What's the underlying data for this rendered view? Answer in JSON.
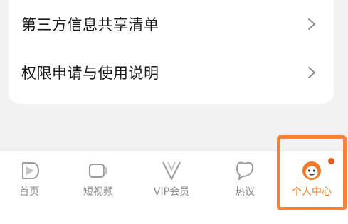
{
  "settings_list": {
    "items": [
      {
        "label": "第三方信息共享清单",
        "icon": "chevron-right-icon"
      },
      {
        "label": "权限申请与使用说明",
        "icon": "chevron-right-icon"
      }
    ]
  },
  "tab_bar": {
    "tabs": [
      {
        "label": "首页",
        "icon": "home-play-icon",
        "active": false
      },
      {
        "label": "短视频",
        "icon": "video-camera-icon",
        "active": false
      },
      {
        "label": "VIP会员",
        "icon": "vip-v-icon",
        "active": false
      },
      {
        "label": "热议",
        "icon": "comment-bubble-icon",
        "active": false
      },
      {
        "label": "个人中心",
        "icon": "profile-face-icon",
        "active": true,
        "badge": "red-dot"
      }
    ]
  },
  "colors": {
    "accent": "#f07a25",
    "highlight_frame": "#f0843c",
    "badge_dot": "#f2541e",
    "inactive_text": "#8a8a8a",
    "page_background": "#f2f2f2"
  }
}
